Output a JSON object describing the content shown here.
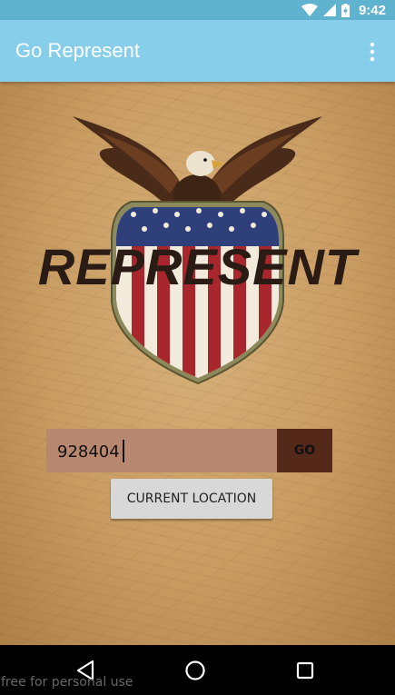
{
  "status_bar": {
    "time": "9:42",
    "icons": [
      "wifi-icon",
      "cell-signal-icon",
      "battery-charging-icon"
    ]
  },
  "app_bar": {
    "title": "Go Represent",
    "menu_icon": "overflow-menu-icon",
    "color": "#87ceeb"
  },
  "main": {
    "logo_text": "REPRESENT",
    "emblem": "eagle-shield-emblem",
    "zip_input": {
      "value": "928404",
      "placeholder": ""
    },
    "go_label": "GO",
    "current_location_label": "CURRENT LOCATION"
  },
  "nav_bar": {
    "icons": [
      "back-icon",
      "home-icon",
      "recents-icon"
    ]
  },
  "watermark": "free for personal use"
}
